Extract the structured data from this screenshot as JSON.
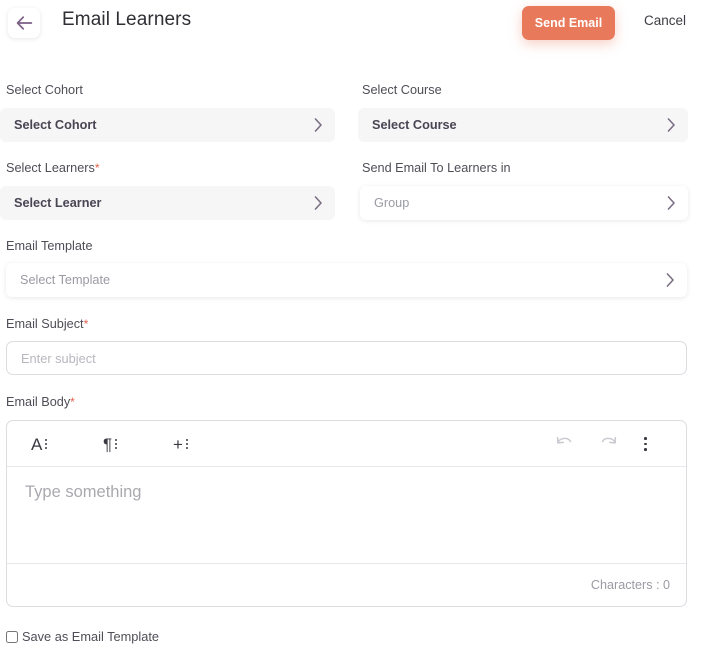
{
  "header": {
    "back_icon": "arrow-left-icon",
    "title": "Email Learners",
    "send_label": "Send Email",
    "cancel_label": "Cancel",
    "accent_color": "#e8795a"
  },
  "form": {
    "cohort": {
      "label": "Select Cohort",
      "value": "Select Cohort",
      "required": false,
      "style": "filled"
    },
    "course": {
      "label": "Select Course",
      "value": "Select Course",
      "required": false,
      "style": "filled"
    },
    "learners": {
      "label": "Select Learners",
      "required_mark": "*",
      "value": "Select Learner",
      "required": true,
      "style": "filled"
    },
    "send_to": {
      "label": "Send Email To Learners in",
      "value": "Group",
      "required": false,
      "style": "card"
    },
    "template": {
      "label": "Email Template",
      "value": "Select Template",
      "required": false,
      "style": "card"
    },
    "subject": {
      "label": "Email Subject",
      "required_mark": "*",
      "value": "",
      "placeholder": "Enter subject"
    },
    "body": {
      "label": "Email Body",
      "required_mark": "*",
      "placeholder": "Type something",
      "char_count": "Characters : 0",
      "toolbar": {
        "text_style_glyph": "A",
        "paragraph_style_glyph": "¶",
        "insert_glyph": "+",
        "undo_icon": "undo-icon",
        "redo_icon": "redo-icon",
        "more_icon": "more-vertical-icon"
      }
    },
    "save_template": {
      "label": "Save as Email Template",
      "checked": false
    }
  }
}
